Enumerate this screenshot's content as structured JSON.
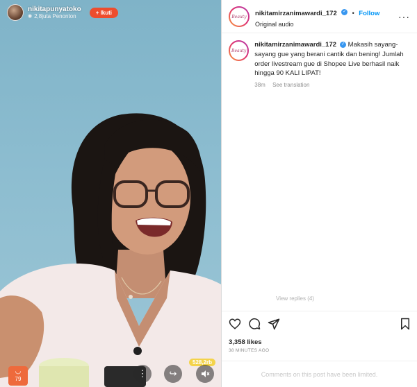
{
  "live": {
    "host_name": "nikitapunyatoko",
    "viewers": "2,8juta Penonton",
    "follow_label": "+ Ikuti",
    "cart_count": "79",
    "like_count": "528,2rb"
  },
  "post": {
    "username": "nikitamirzanimawardi_172",
    "follow_label": "Follow",
    "audio": "Original audio",
    "avatar_text": "Beauty",
    "caption": "Makasih sayang-sayang gue yang berani cantik dan bening! Jumlah order livestream gue di Shopee Live berhasil naik hingga 90 KALI LIPAT!",
    "caption_age": "38m",
    "see_translation": "See translation",
    "view_replies": "View replies (4)",
    "likes": "3,358 likes",
    "time_ago": "38 MINUTES AGO",
    "comments_limited": "Comments on this post have been limited."
  },
  "icons": {
    "like": "heart-icon",
    "comment": "comment-icon",
    "share": "send-icon",
    "save": "bookmark-icon",
    "more": "more-icon",
    "verified": "verified-badge-icon"
  },
  "colors": {
    "follow_blue": "#0095f6",
    "verified_blue": "#3897f0",
    "shopee_orange": "#ee4d2d",
    "like_yellow": "#f4d34a"
  }
}
